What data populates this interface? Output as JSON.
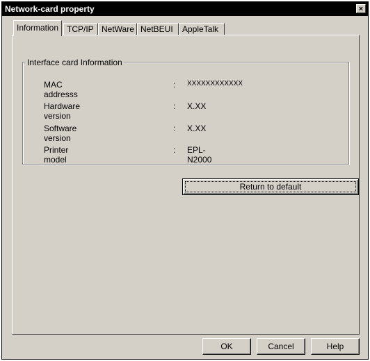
{
  "window": {
    "title": "Network-card property"
  },
  "tabs": [
    {
      "label": "Information",
      "active": true
    },
    {
      "label": "TCP/IP",
      "active": false
    },
    {
      "label": "NetWare",
      "active": false
    },
    {
      "label": "NetBEUI",
      "active": false
    },
    {
      "label": "AppleTalk",
      "active": false
    }
  ],
  "group": {
    "title": "Interface card Information",
    "rows": [
      {
        "label": "MAC addresss",
        "colon": ":",
        "value": "XXXXXXXXXXXX"
      },
      {
        "label": "Hardware version",
        "colon": ":",
        "value": "X.XX"
      },
      {
        "label": "Software version",
        "colon": ":",
        "value": "X.XX"
      },
      {
        "label": "Printer model",
        "colon": ":",
        "value": "EPL-N2000"
      }
    ]
  },
  "buttons": {
    "return_default": "Return to default",
    "ok": "OK",
    "cancel": "Cancel",
    "help": "Help",
    "close": "×"
  }
}
